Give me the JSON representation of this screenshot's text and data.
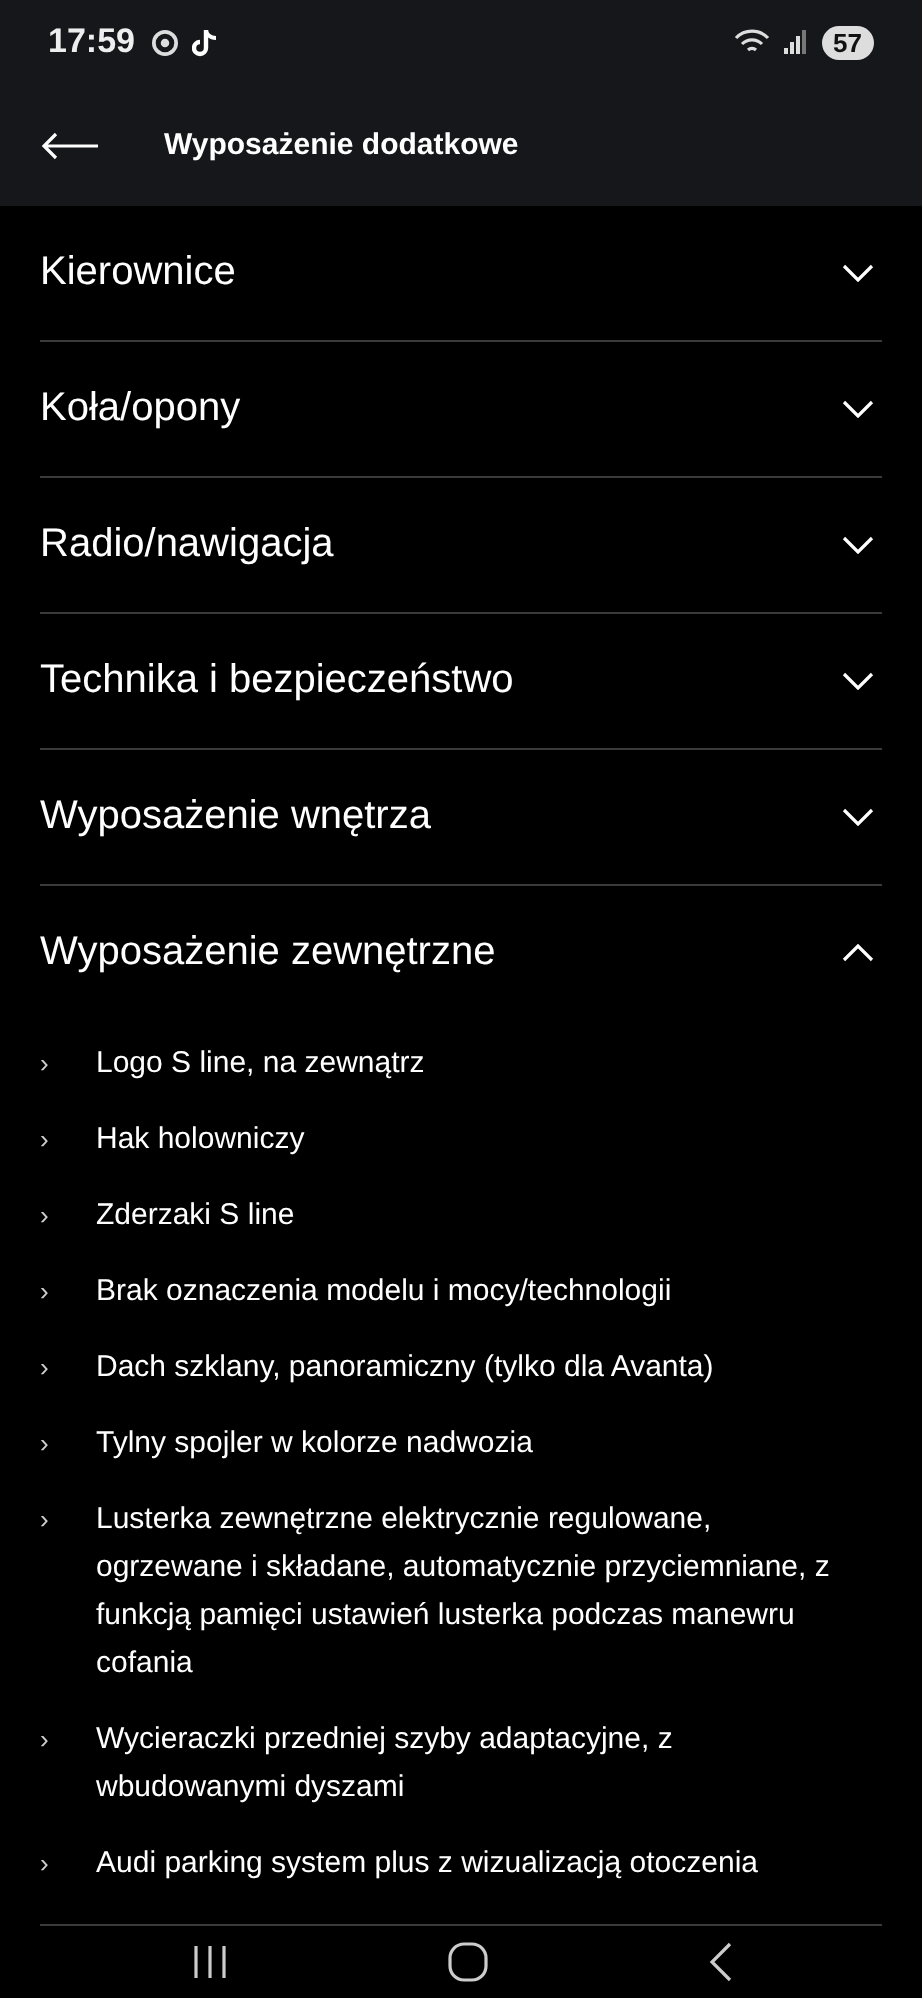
{
  "status_bar": {
    "time": "17:59",
    "battery": "57"
  },
  "header": {
    "title": "Wyposażenie dodatkowe"
  },
  "sections": [
    {
      "title": "Kierownice",
      "expanded": false
    },
    {
      "title": "Koła/opony",
      "expanded": false
    },
    {
      "title": "Radio/nawigacja",
      "expanded": false
    },
    {
      "title": "Technika i bezpieczeństwo",
      "expanded": false
    },
    {
      "title": "Wyposażenie wnętrza",
      "expanded": false
    },
    {
      "title": "Wyposażenie zewnętrzne",
      "expanded": true,
      "items": [
        {
          "bullet": "›",
          "text": "Logo S line, na zewnątrz"
        },
        {
          "bullet": "›",
          "text": "Hak holowniczy"
        },
        {
          "bullet": "›",
          "text": "Zderzaki S line"
        },
        {
          "bullet": "›",
          "text": "Brak oznaczenia modelu i mocy/technologii"
        },
        {
          "bullet": "›",
          "text": "Dach szklany, panoramiczny (tylko dla Avanta)"
        },
        {
          "bullet": "›",
          "text": "Tylny spojler w kolorze nadwozia"
        },
        {
          "bullet": "›",
          "text": "Lusterka zewnętrzne elektrycznie regulowane, ogrzewane i składane, automatycznie przyciemniane, z funkcją pamięci ustawień lusterka podczas manewru cofania"
        },
        {
          "bullet": "›",
          "text": "Wycieraczki przedniej szyby adaptacyjne, z wbudowanymi dyszami"
        },
        {
          "bullet": "›",
          "text": "Audi parking system plus z wizualizacją otoczenia"
        }
      ]
    }
  ]
}
